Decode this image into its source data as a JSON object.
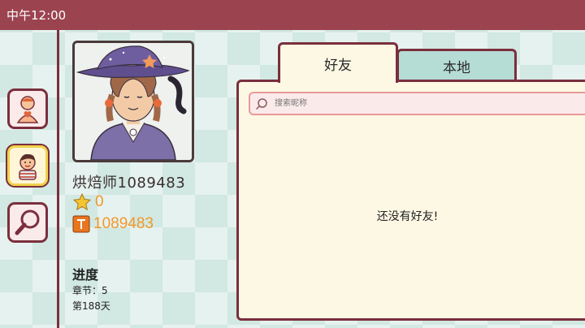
{
  "status_bar": {
    "time": "中午12:00"
  },
  "nav": [
    {
      "name": "family",
      "icon": "person-with-heart-icon"
    },
    {
      "name": "friends",
      "icon": "boy-avatar-icon",
      "active": true
    },
    {
      "name": "search",
      "icon": "magnifier-icon"
    }
  ],
  "profile": {
    "name": "烘焙师1089483",
    "stars": "0",
    "id": "1089483",
    "progress_title": "进度",
    "chapter": "章节：5",
    "day": "第188天"
  },
  "tabs": [
    {
      "label": "好友",
      "active": true
    },
    {
      "label": "本地",
      "active": false
    }
  ],
  "search": {
    "placeholder": "搜索昵称"
  },
  "empty_message": "还没有好友!",
  "colors": {
    "status_bar": "#9c4350",
    "border": "#7a2f3d",
    "panel": "#fdf8e4",
    "tab_inactive": "#b6dcd6",
    "accent_orange": "#f0982a",
    "search_bg": "#fbeaea"
  }
}
